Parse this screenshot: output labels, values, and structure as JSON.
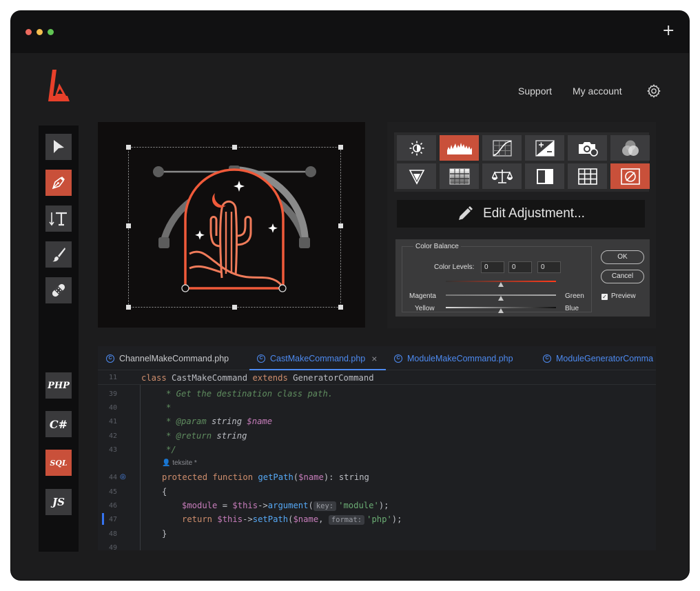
{
  "window": {
    "dots": [
      "#ec6a5e",
      "#f4bf4f",
      "#61c554"
    ],
    "new_tab_label": "+"
  },
  "header": {
    "nav": [
      "Support",
      "My account"
    ],
    "settings_icon": "gear-icon",
    "brand_color": "#e8402a"
  },
  "toolbar": {
    "tools": [
      {
        "name": "select",
        "icon": "cursor-arrow-icon",
        "active": false
      },
      {
        "name": "pen",
        "icon": "pen-nib-icon",
        "active": true
      },
      {
        "name": "text",
        "icon": "text-tool-icon",
        "active": false
      },
      {
        "name": "brush",
        "icon": "brush-icon",
        "active": false
      },
      {
        "name": "healing",
        "icon": "bandage-icon",
        "active": false
      }
    ],
    "languages": [
      {
        "label": "PHP",
        "active": false
      },
      {
        "label": "C#",
        "active": false
      },
      {
        "label": "SQL",
        "active": true
      },
      {
        "label": "JS",
        "active": false
      }
    ]
  },
  "adjustments": {
    "buttons": [
      {
        "icon": "brightness-icon",
        "active": false
      },
      {
        "icon": "levels-icon",
        "active": true
      },
      {
        "icon": "curves-icon",
        "active": false
      },
      {
        "icon": "exposure-icon",
        "active": false
      },
      {
        "icon": "camera-filter-icon",
        "active": false
      },
      {
        "icon": "channel-mixer-icon",
        "active": false
      },
      {
        "icon": "vibrance-icon",
        "active": false
      },
      {
        "icon": "gradient-map-icon",
        "active": false
      },
      {
        "icon": "color-balance-icon",
        "active": false
      },
      {
        "icon": "black-white-icon",
        "active": false
      },
      {
        "icon": "grid-icon",
        "active": false
      },
      {
        "icon": "invert-icon",
        "active": true
      }
    ],
    "edit_label": "Edit Adjustment..."
  },
  "color_balance": {
    "title": "Color Balance",
    "levels_label": "Color Levels:",
    "levels": [
      "0",
      "0",
      "0"
    ],
    "left_labels": [
      "Magenta",
      "Yellow"
    ],
    "right_labels": [
      "Green",
      "Blue"
    ],
    "ok": "OK",
    "cancel": "Cancel",
    "preview": "Preview",
    "preview_checked": true
  },
  "editor": {
    "tabs": [
      {
        "label": "ChannelMakeCommand.php",
        "active": false
      },
      {
        "label": "CastMakeCommand.php",
        "active": true,
        "close": "×"
      },
      {
        "label": "ModuleMakeCommand.php",
        "active": false
      },
      {
        "label": "ModuleGeneratorComma",
        "active": false
      }
    ],
    "sticky": {
      "line": "11",
      "text": [
        "class",
        " CastMakeCommand ",
        "extends",
        " GeneratorCommand"
      ]
    },
    "line_numbers": [
      "39",
      "40",
      "41",
      "42",
      "43",
      "44",
      "45",
      "46",
      "47",
      "48",
      "49"
    ],
    "author_hint": "teksite *",
    "lines": {
      "l39": "* Get the destination class path.",
      "l40": "*",
      "l41_tag": "* @param",
      "l41_type": " string ",
      "l41_var": "$name",
      "l42_tag": "* @return",
      "l42_type": " string",
      "l43": "*/",
      "l44_kw": "protected function ",
      "l44_fn": "getPath",
      "l44_p1": "(",
      "l44_var": "$name",
      "l44_p2": "): string",
      "l45": "{",
      "l46_var": "$module",
      "l46_eq": " = ",
      "l46_this": "$this",
      "l46_arrow": "->",
      "l46_fn": "argument",
      "l46_p1": "(",
      "l46_hint": "key:",
      "l46_str": "'module'",
      "l46_end": ");",
      "l47_kw": "return ",
      "l47_this": "$this",
      "l47_arrow": "->",
      "l47_fn": "setPath",
      "l47_p1": "(",
      "l47_var": "$name",
      "l47_comma": ", ",
      "l47_hint": "format:",
      "l47_str": "'php'",
      "l47_end": ");",
      "l48": "}"
    }
  }
}
